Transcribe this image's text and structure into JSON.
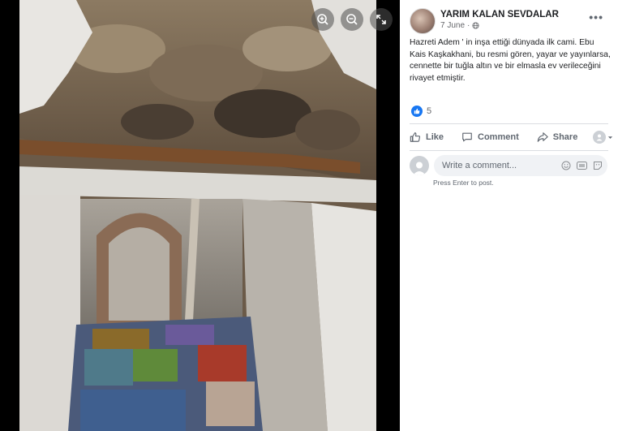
{
  "viewer": {
    "zoom_in_icon": "zoom-in-icon",
    "zoom_out_icon": "zoom-out-icon",
    "fullscreen_icon": "fullscreen-icon"
  },
  "post": {
    "page_name": "YARIM KALAN SEVDALAR",
    "date": "7 June",
    "privacy_icon": "globe-icon",
    "text": "Hazreti Adem ' in inşa ettiği dünyada ilk cami. Ebu Kais Kaşkakhani, bu resmi gören, yayar ve yayınlarsa, cennette bir tuğla altın ve bir elmasla ev verileceğini rivayet etmiştir.",
    "reaction_count": "5"
  },
  "actions": {
    "like": "Like",
    "comment": "Comment",
    "share": "Share"
  },
  "comment_box": {
    "placeholder": "Write a comment...",
    "hint": "Press Enter to post."
  },
  "colors": {
    "brand": "#1877f2",
    "text": "#1c1e21",
    "muted": "#65676b",
    "input_bg": "#f0f2f5"
  }
}
